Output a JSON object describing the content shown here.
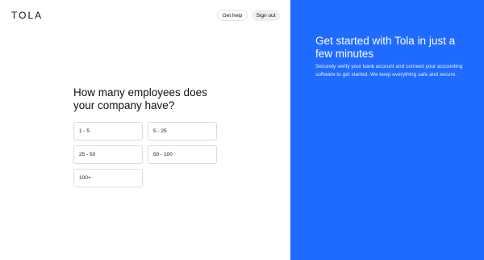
{
  "header": {
    "logo": "TOLA",
    "help_label": "Get help",
    "signout_label": "Sign out"
  },
  "main": {
    "question": "How many employees does your company have?",
    "options": [
      {
        "label": "1 - 5"
      },
      {
        "label": "5 - 25"
      },
      {
        "label": "25 - 50"
      },
      {
        "label": "50 - 100"
      },
      {
        "label": "100+"
      }
    ]
  },
  "side_panel": {
    "heading": "Get started with Tola in just a few minutes",
    "description": "Securely verify your bank account and connect your accounting software to get started. We keep everything safe and secure.",
    "background_color": "#1f6bff"
  }
}
